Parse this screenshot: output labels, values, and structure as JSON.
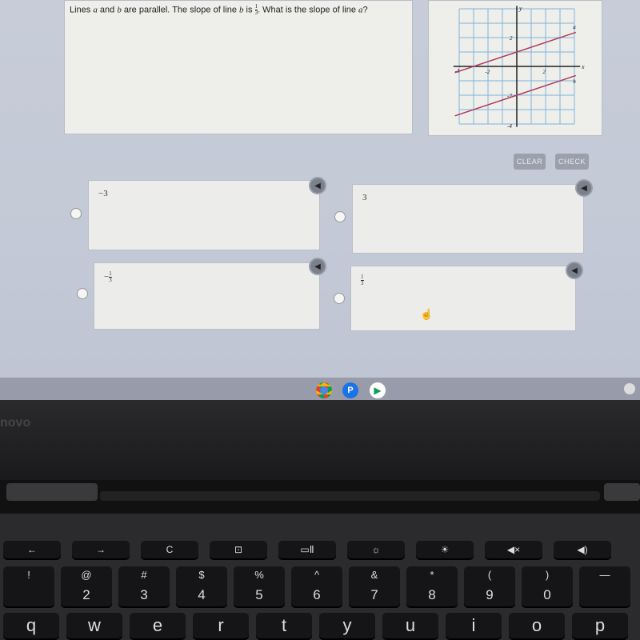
{
  "question": {
    "prefix": "Lines ",
    "var_a": "a",
    "and": " and ",
    "var_b": "b",
    "mid": " are parallel. The slope of line ",
    "var_b2": "b",
    "is": " is ",
    "frac_num": "1",
    "frac_den": "3",
    "suffix": ". What is the slope of line ",
    "var_a2": "a",
    "end": "?"
  },
  "graph": {
    "x_label": "x",
    "y_label": "y",
    "line_a_label": "a",
    "line_b_label": "b",
    "ticks": {
      "x_neg4": "-4",
      "x_neg2": "-2",
      "x_2": "2",
      "y_2": "2",
      "y_neg2": "-2",
      "y_neg4": "-4"
    },
    "range": [
      -4,
      4
    ],
    "line_a": {
      "slope": "1/3",
      "intercept": 1
    },
    "line_b": {
      "slope": "1/3",
      "intercept": -2
    },
    "line_color": "#b03a5b",
    "grid_color": "#7fb3d9"
  },
  "buttons": {
    "clear": "CLEAR",
    "check": "CHECK"
  },
  "options": [
    {
      "label": "−3"
    },
    {
      "label": "3"
    },
    {
      "sign": "−",
      "num": "1",
      "den": "3"
    },
    {
      "num": "1",
      "den": "3"
    }
  ],
  "speaker_icon": "speaker-icon",
  "shelf_apps": [
    "chrome-icon",
    "app-p-icon",
    "play-store-icon"
  ],
  "brand": "novo",
  "keyboard": {
    "fn_row": [
      "←",
      "→",
      "C",
      "⊡",
      "▭Ⅱ",
      "☼",
      "☀",
      "◀×",
      "◀)"
    ],
    "num_row": [
      {
        "t": "!",
        "b": ""
      },
      {
        "t": "@",
        "b": "2"
      },
      {
        "t": "#",
        "b": "3"
      },
      {
        "t": "$",
        "b": "4"
      },
      {
        "t": "%",
        "b": "5"
      },
      {
        "t": "^",
        "b": "6"
      },
      {
        "t": "&",
        "b": "7"
      },
      {
        "t": "*",
        "b": "8"
      },
      {
        "t": "(",
        "b": "9"
      },
      {
        "t": ")",
        "b": "0"
      },
      {
        "t": "—",
        "b": ""
      }
    ],
    "letter_row": [
      "q",
      "w",
      "e",
      "r",
      "t",
      "y",
      "u",
      "i",
      "o",
      "p"
    ]
  }
}
